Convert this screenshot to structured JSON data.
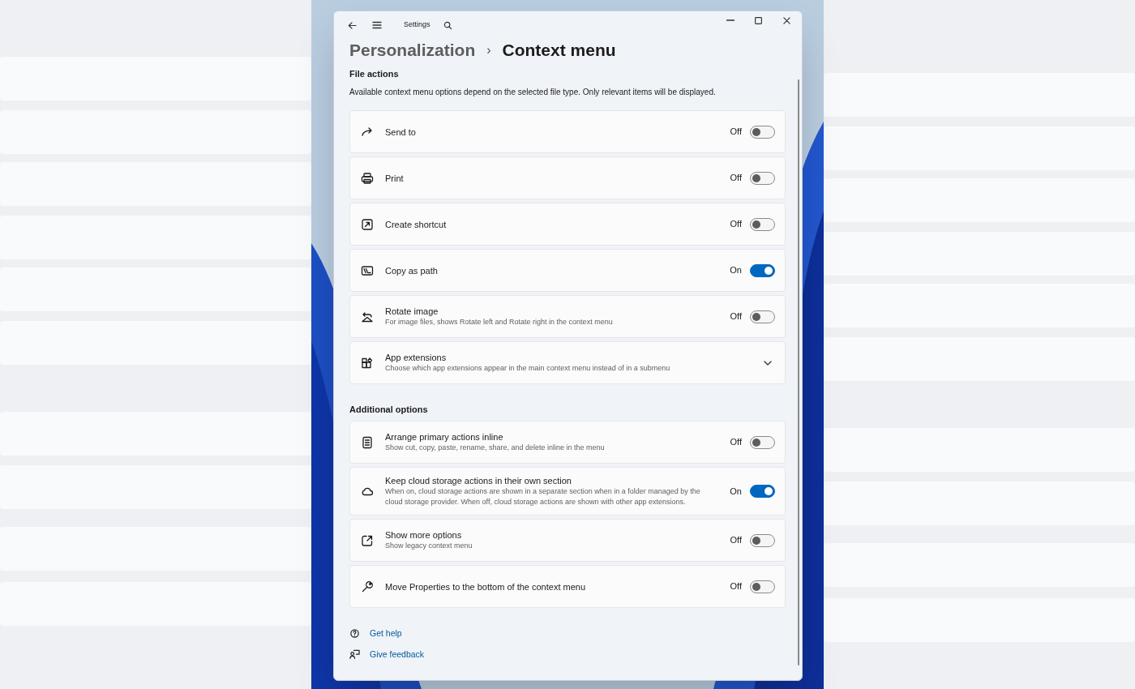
{
  "window": {
    "title": "Settings"
  },
  "breadcrumb": {
    "parent": "Personalization",
    "separator": "›",
    "current": "Context menu"
  },
  "sections": [
    {
      "title": "File actions",
      "description": "Available context menu options depend on the selected file type. Only relevant items will be displayed.",
      "items": [
        {
          "kind": "toggle",
          "title": "Send to",
          "state_label": "Off",
          "on": false
        },
        {
          "kind": "toggle",
          "title": "Print",
          "state_label": "Off",
          "on": false
        },
        {
          "kind": "toggle",
          "title": "Create shortcut",
          "state_label": "Off",
          "on": false
        },
        {
          "kind": "toggle",
          "title": "Copy as path",
          "state_label": "On",
          "on": true
        },
        {
          "kind": "toggle",
          "title": "Rotate image",
          "description": "For image files, shows Rotate left and Rotate right in the context menu",
          "state_label": "Off",
          "on": false
        },
        {
          "kind": "expander",
          "title": "App extensions",
          "description": "Choose which app extensions appear in the main context menu instead of in a submenu",
          "expanded": false
        }
      ]
    },
    {
      "title": "Additional options",
      "items": [
        {
          "kind": "toggle",
          "title": "Arrange primary actions inline",
          "description": "Show cut, copy, paste, rename, share, and delete inline in the menu",
          "state_label": "Off",
          "on": false
        },
        {
          "kind": "toggle",
          "title": "Keep cloud storage actions in their own section",
          "description": "When on, cloud storage actions are shown in a separate section when in a folder managed by the cloud storage provider. When off, cloud storage actions are shown with other app extensions.",
          "state_label": "On",
          "on": true
        },
        {
          "kind": "toggle",
          "title": "Show more options",
          "description": "Show legacy context menu",
          "state_label": "Off",
          "on": false
        },
        {
          "kind": "toggle",
          "title": "Move Properties to the bottom of the context menu",
          "state_label": "Off",
          "on": false
        }
      ]
    }
  ],
  "links": [
    "Get help",
    "Give feedback"
  ]
}
